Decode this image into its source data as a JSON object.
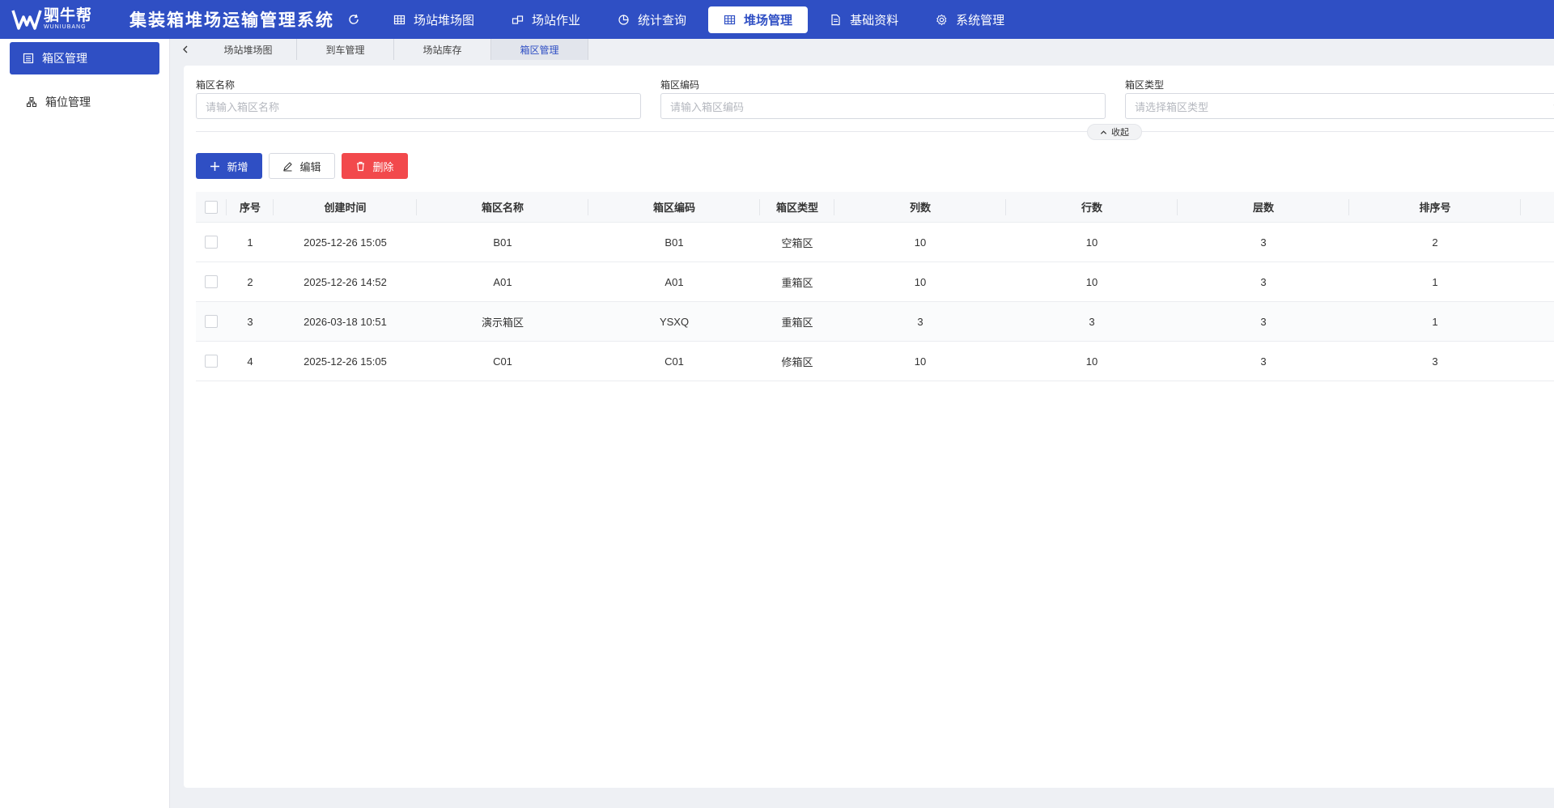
{
  "header": {
    "logo_cn": "驷牛帮",
    "logo_en": "WUNIUBANG",
    "title": "集装箱堆场运输管理系统",
    "nav": [
      {
        "label": "场站堆场图",
        "icon": "grid-icon"
      },
      {
        "label": "场站作业",
        "icon": "work-icon"
      },
      {
        "label": "统计查询",
        "icon": "pie-chart-icon"
      },
      {
        "label": "堆场管理",
        "icon": "table-icon"
      },
      {
        "label": "基础资料",
        "icon": "document-icon"
      },
      {
        "label": "系统管理",
        "icon": "gear-icon"
      }
    ],
    "active_nav": "堆场管理"
  },
  "sidebar": {
    "items": [
      {
        "label": "箱区管理",
        "icon": "area-icon"
      },
      {
        "label": "箱位管理",
        "icon": "hierarchy-icon"
      }
    ]
  },
  "tabs": [
    {
      "label": "场站堆场图"
    },
    {
      "label": "到车管理"
    },
    {
      "label": "场站库存"
    },
    {
      "label": "箱区管理"
    }
  ],
  "filters": {
    "name": {
      "label": "箱区名称",
      "placeholder": "请输入箱区名称"
    },
    "code": {
      "label": "箱区编码",
      "placeholder": "请输入箱区编码"
    },
    "type": {
      "label": "箱区类型",
      "placeholder": "请选择箱区类型"
    },
    "collapse_label": "收起"
  },
  "toolbar": {
    "add_label": "新增",
    "edit_label": "编辑",
    "delete_label": "删除"
  },
  "table": {
    "headers": [
      "序号",
      "创建时间",
      "箱区名称",
      "箱区编码",
      "箱区类型",
      "列数",
      "行数",
      "层数",
      "排序号"
    ],
    "rows": [
      [
        "1",
        "2025-12-26 15:05",
        "B01",
        "B01",
        "空箱区",
        "10",
        "10",
        "3",
        "2"
      ],
      [
        "2",
        "2025-12-26 14:52",
        "A01",
        "A01",
        "重箱区",
        "10",
        "10",
        "3",
        "1"
      ],
      [
        "3",
        "2026-03-18 10:51",
        "演示箱区",
        "YSXQ",
        "重箱区",
        "3",
        "3",
        "3",
        "1"
      ],
      [
        "4",
        "2025-12-26 15:05",
        "C01",
        "C01",
        "修箱区",
        "10",
        "10",
        "3",
        "3"
      ]
    ]
  }
}
